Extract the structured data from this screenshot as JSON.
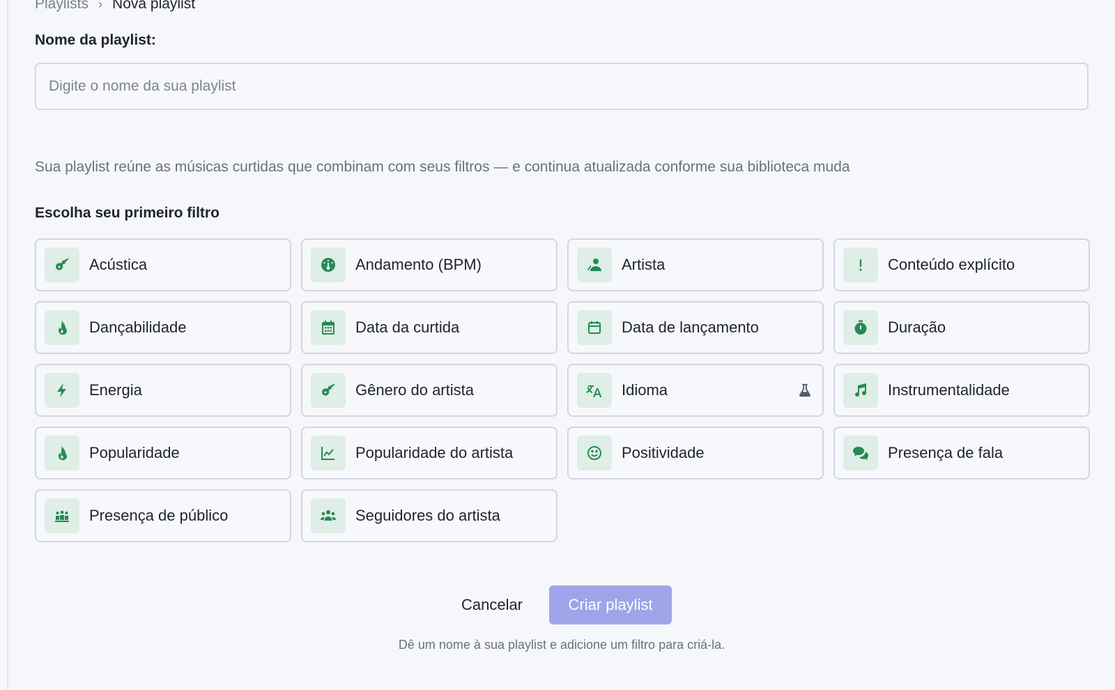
{
  "breadcrumb": {
    "parent": "Playlists",
    "separator": "›",
    "current": "Nova playlist"
  },
  "form": {
    "name_label": "Nome da playlist:",
    "name_placeholder": "Digite o nome da sua playlist",
    "name_value": ""
  },
  "description": "Sua playlist reúne as músicas curtidas que combinam com seus filtros — e continua atualizada conforme sua biblioteca muda",
  "filters_title": "Escolha seu primeiro filtro",
  "filters": [
    {
      "label": "Acústica",
      "icon": "guitar-icon"
    },
    {
      "label": "Andamento (BPM)",
      "icon": "gauge-icon"
    },
    {
      "label": "Artista",
      "icon": "artist-icon"
    },
    {
      "label": "Conteúdo explícito",
      "icon": "exclamation-icon"
    },
    {
      "label": "Dançabilidade",
      "icon": "fire-icon"
    },
    {
      "label": "Data da curtida",
      "icon": "calendar-filled-icon"
    },
    {
      "label": "Data de lançamento",
      "icon": "calendar-outline-icon"
    },
    {
      "label": "Duração",
      "icon": "stopwatch-icon"
    },
    {
      "label": "Energia",
      "icon": "bolt-icon"
    },
    {
      "label": "Gênero do artista",
      "icon": "guitar-icon"
    },
    {
      "label": "Idioma",
      "icon": "translate-icon",
      "badge": "flask-icon"
    },
    {
      "label": "Instrumentalidade",
      "icon": "music-note-icon"
    },
    {
      "label": "Popularidade",
      "icon": "fire-icon"
    },
    {
      "label": "Popularidade do artista",
      "icon": "chart-line-icon"
    },
    {
      "label": "Positividade",
      "icon": "smile-icon"
    },
    {
      "label": "Presença de fala",
      "icon": "chat-icon"
    },
    {
      "label": "Presença de público",
      "icon": "crowd-icon"
    },
    {
      "label": "Seguidores do artista",
      "icon": "users-icon"
    }
  ],
  "actions": {
    "cancel_label": "Cancelar",
    "create_label": "Criar playlist"
  },
  "hint": "Dê um nome à sua playlist e adicione um filtro para criá-la.",
  "colors": {
    "accent_green": "#268a55",
    "icon_bg": "#dfeee6",
    "create_button_disabled": "#9fa4e9"
  }
}
